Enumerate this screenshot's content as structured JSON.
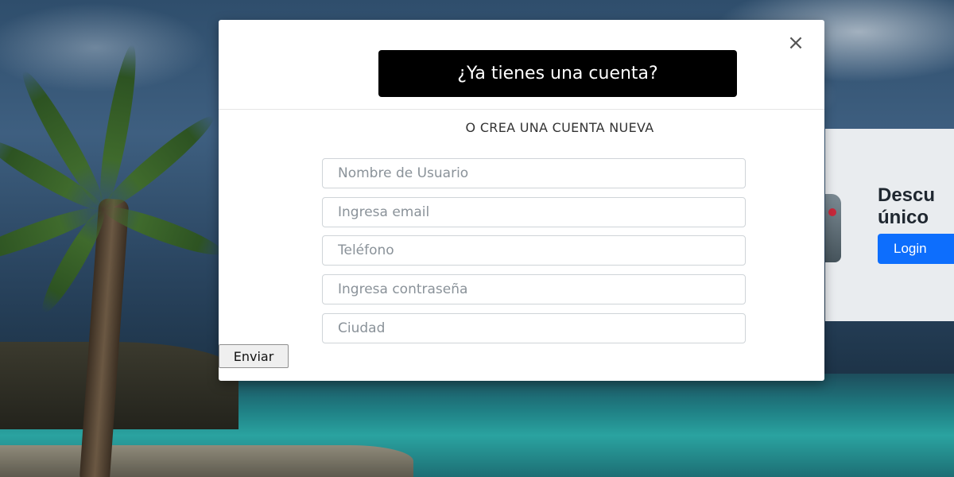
{
  "background": {
    "card": {
      "title": "Descu\núnico",
      "login_label": "Login"
    }
  },
  "modal": {
    "close_symbol": "×",
    "login_prompt_label": "¿Ya tienes una cuenta?",
    "section_heading": "O CREA UNA CUENTA NUEVA",
    "fields": {
      "username": {
        "placeholder": "Nombre de Usuario",
        "value": ""
      },
      "email": {
        "placeholder": "Ingresa email",
        "value": ""
      },
      "phone": {
        "placeholder": "Teléfono",
        "value": ""
      },
      "password": {
        "placeholder": "Ingresa contraseña",
        "value": ""
      },
      "city": {
        "placeholder": "Ciudad",
        "value": ""
      }
    },
    "submit_label": "Enviar"
  },
  "colors": {
    "login_prompt_bg": "#000000",
    "background_login_button": "#0d6efd"
  }
}
